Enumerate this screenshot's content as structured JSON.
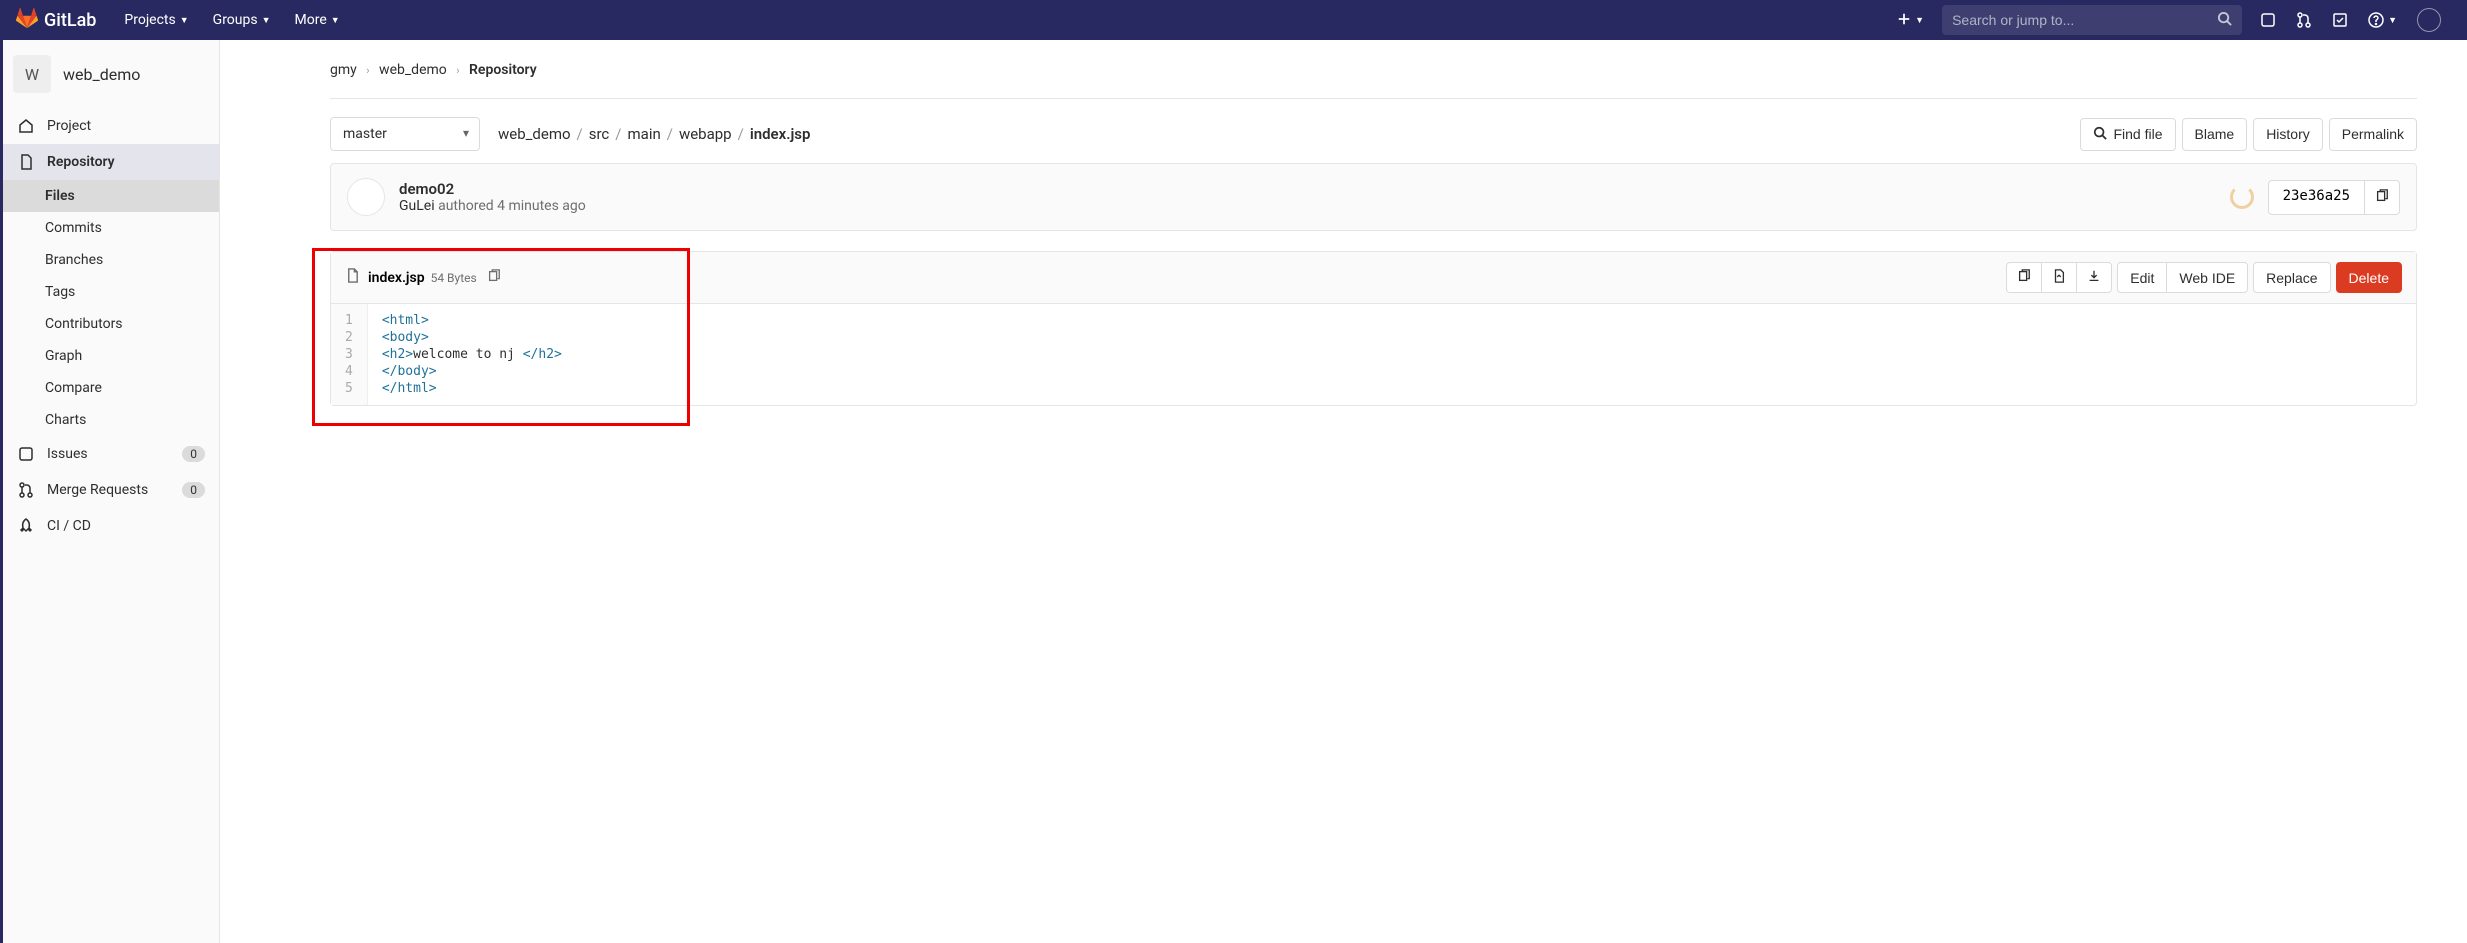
{
  "nav": {
    "brand": "GitLab",
    "projects": "Projects",
    "groups": "Groups",
    "more": "More",
    "search_placeholder": "Search or jump to..."
  },
  "sidebar": {
    "project_letter": "W",
    "project_name": "web_demo",
    "items": {
      "project": "Project",
      "repository": "Repository",
      "issues": "Issues",
      "issues_count": "0",
      "merge_requests": "Merge Requests",
      "mr_count": "0",
      "cicd": "CI / CD"
    },
    "sub": {
      "files": "Files",
      "commits": "Commits",
      "branches": "Branches",
      "tags": "Tags",
      "contributors": "Contributors",
      "graph": "Graph",
      "compare": "Compare",
      "charts": "Charts"
    }
  },
  "breadcrumb": {
    "a": "gmy",
    "b": "web_demo",
    "c": "Repository"
  },
  "branch": "master",
  "path": {
    "p0": "web_demo",
    "p1": "src",
    "p2": "main",
    "p3": "webapp",
    "file": "index.jsp"
  },
  "actions": {
    "find": "Find file",
    "blame": "Blame",
    "history": "History",
    "permalink": "Permalink"
  },
  "commit": {
    "title": "demo02",
    "author": "GuLei",
    "verb": " authored ",
    "time": "4 minutes ago",
    "sha": "23e36a25"
  },
  "file": {
    "name": "index.jsp",
    "size": "54 Bytes",
    "edit": "Edit",
    "webide": "Web IDE",
    "replace": "Replace",
    "delete": "Delete"
  },
  "code": {
    "l1a": "<html>",
    "l2a": "<body>",
    "l3a": "<h2>",
    "l3b": "welcome to nj ",
    "l3c": "</h2>",
    "l4a": "</body>",
    "l5a": "</html>"
  }
}
